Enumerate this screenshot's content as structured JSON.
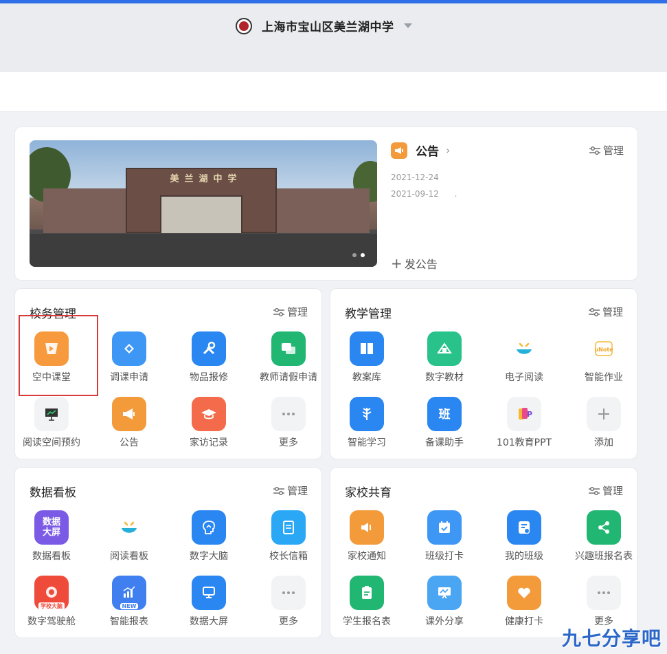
{
  "school": {
    "name": "上海市宝山区美兰湖中学"
  },
  "banner": {
    "gate_text": "美兰湖中学"
  },
  "notice": {
    "title": "公告",
    "manage_label": "管理",
    "items": [
      {
        "date": "2021-12-24",
        "text": ""
      },
      {
        "date": "2021-09-12",
        "text": "."
      }
    ],
    "post_label": "发公告"
  },
  "sections": [
    {
      "title": "校务管理",
      "manage_label": "管理",
      "items": [
        {
          "label": "空中课堂",
          "icon": "air-classroom-icon",
          "color": "#f79a3e"
        },
        {
          "label": "调课申请",
          "icon": "swap-course-icon",
          "color": "#3f97f5"
        },
        {
          "label": "物品报修",
          "icon": "repair-tools-icon",
          "color": "#2a86f0"
        },
        {
          "label": "教师请假申请",
          "icon": "chat-leave-icon",
          "color": "#22b673"
        },
        {
          "label": "阅读空间预约",
          "icon": "presentation-board-icon",
          "color": "#f2f3f5"
        },
        {
          "label": "公告",
          "icon": "megaphone-icon",
          "color": "#f39a3b"
        },
        {
          "label": "家访记录",
          "icon": "graduation-cap-icon",
          "color": "#f46b4b"
        },
        {
          "label": "更多",
          "icon": "more-dots-icon",
          "color": "#f2f3f5"
        }
      ]
    },
    {
      "title": "教学管理",
      "manage_label": "管理",
      "items": [
        {
          "label": "教案库",
          "icon": "book-icon",
          "color": "#2a86f0"
        },
        {
          "label": "数字教材",
          "icon": "digital-textbook-icon",
          "color": "#29c28a"
        },
        {
          "label": "电子阅读",
          "icon": "reading-face-icon",
          "color": "#ffffff"
        },
        {
          "label": "智能作业",
          "icon": "unote-icon",
          "color": "#ffffff"
        },
        {
          "label": "智能学习",
          "icon": "plant-learning-icon",
          "color": "#2a86f0"
        },
        {
          "label": "备课助手",
          "icon": "class-ban-icon",
          "color": "#2a86f0"
        },
        {
          "label": "101教育PPT",
          "icon": "ppt-icon",
          "color": "#f2f3f5"
        },
        {
          "label": "添加",
          "icon": "plus-icon",
          "color": "#f2f3f5"
        }
      ]
    },
    {
      "title": "数据看板",
      "manage_label": "管理",
      "items": [
        {
          "label": "数据看板",
          "icon": "data-screen-icon",
          "color": "#7b5be6",
          "badge": "数据大屏"
        },
        {
          "label": "阅读看板",
          "icon": "reading-face-icon",
          "color": "#ffffff"
        },
        {
          "label": "数字大脑",
          "icon": "brain-icon",
          "color": "#2a86f0"
        },
        {
          "label": "校长信箱",
          "icon": "mailbox-icon",
          "color": "#2aa8f5"
        },
        {
          "label": "数字驾驶舱",
          "icon": "cockpit-icon",
          "color": "#ef4b3b",
          "badge": "学校大脑"
        },
        {
          "label": "智能报表",
          "icon": "chart-report-icon",
          "color": "#3f7ff0",
          "badge": "NEW"
        },
        {
          "label": "数据大屏",
          "icon": "monitor-icon",
          "color": "#2a86f0"
        },
        {
          "label": "更多",
          "icon": "more-dots-icon",
          "color": "#f2f3f5"
        }
      ]
    },
    {
      "title": "家校共育",
      "manage_label": "管理",
      "items": [
        {
          "label": "家校通知",
          "icon": "speaker-icon",
          "color": "#f39a3b"
        },
        {
          "label": "班级打卡",
          "icon": "calendar-check-icon",
          "color": "#3f97f5"
        },
        {
          "label": "我的班级",
          "icon": "class-card-icon",
          "color": "#2a86f0"
        },
        {
          "label": "兴趣班报名表",
          "icon": "share-nodes-icon",
          "color": "#22b673"
        },
        {
          "label": "学生报名表",
          "icon": "clipboard-icon",
          "color": "#22b673"
        },
        {
          "label": "课外分享",
          "icon": "share-screen-icon",
          "color": "#4aa5f2"
        },
        {
          "label": "健康打卡",
          "icon": "heart-icon",
          "color": "#f39a3b"
        },
        {
          "label": "更多",
          "icon": "more-dots-icon",
          "color": "#f2f3f5"
        }
      ]
    }
  ],
  "watermark": "九七分享吧"
}
